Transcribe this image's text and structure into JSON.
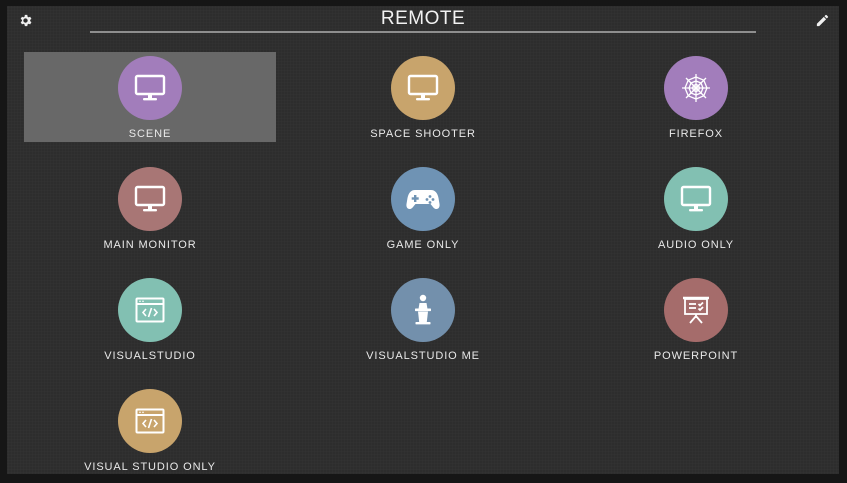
{
  "header": {
    "title": "REMOTE",
    "settings_icon": "gear-icon",
    "edit_icon": "pencil-icon"
  },
  "colors": {
    "background": "#2d2d2d",
    "selected_tile": "#686868",
    "purple": "#a27dbb",
    "tan": "#c8a46c",
    "rose": "#a87675",
    "blue": "#6f93b4",
    "teal": "#82c0b2",
    "slate": "#7390ac",
    "red": "#a56c6b"
  },
  "tiles": [
    {
      "label": "SCENE",
      "icon": "monitor-icon",
      "color": "#a27dbb",
      "selected": true
    },
    {
      "label": "SPACE SHOOTER",
      "icon": "monitor-icon",
      "color": "#c8a46c"
    },
    {
      "label": "FIREFOX",
      "icon": "spiderweb-icon",
      "color": "#a27dbb"
    },
    {
      "label": "MAIN MONITOR",
      "icon": "monitor-icon",
      "color": "#a87675"
    },
    {
      "label": "GAME ONLY",
      "icon": "gamepad-icon",
      "color": "#6f93b4"
    },
    {
      "label": "AUDIO ONLY",
      "icon": "monitor-icon",
      "color": "#82c0b2"
    },
    {
      "label": "VISUALSTUDIO",
      "icon": "code-window-icon",
      "color": "#82c0b2"
    },
    {
      "label": "VISUALSTUDIO ME",
      "icon": "presenter-icon",
      "color": "#7390ac"
    },
    {
      "label": "POWERPOINT",
      "icon": "presentation-board-icon",
      "color": "#a56c6b"
    },
    {
      "label": "VISUAL STUDIO ONLY",
      "icon": "code-window-icon",
      "color": "#c8a46c"
    }
  ]
}
